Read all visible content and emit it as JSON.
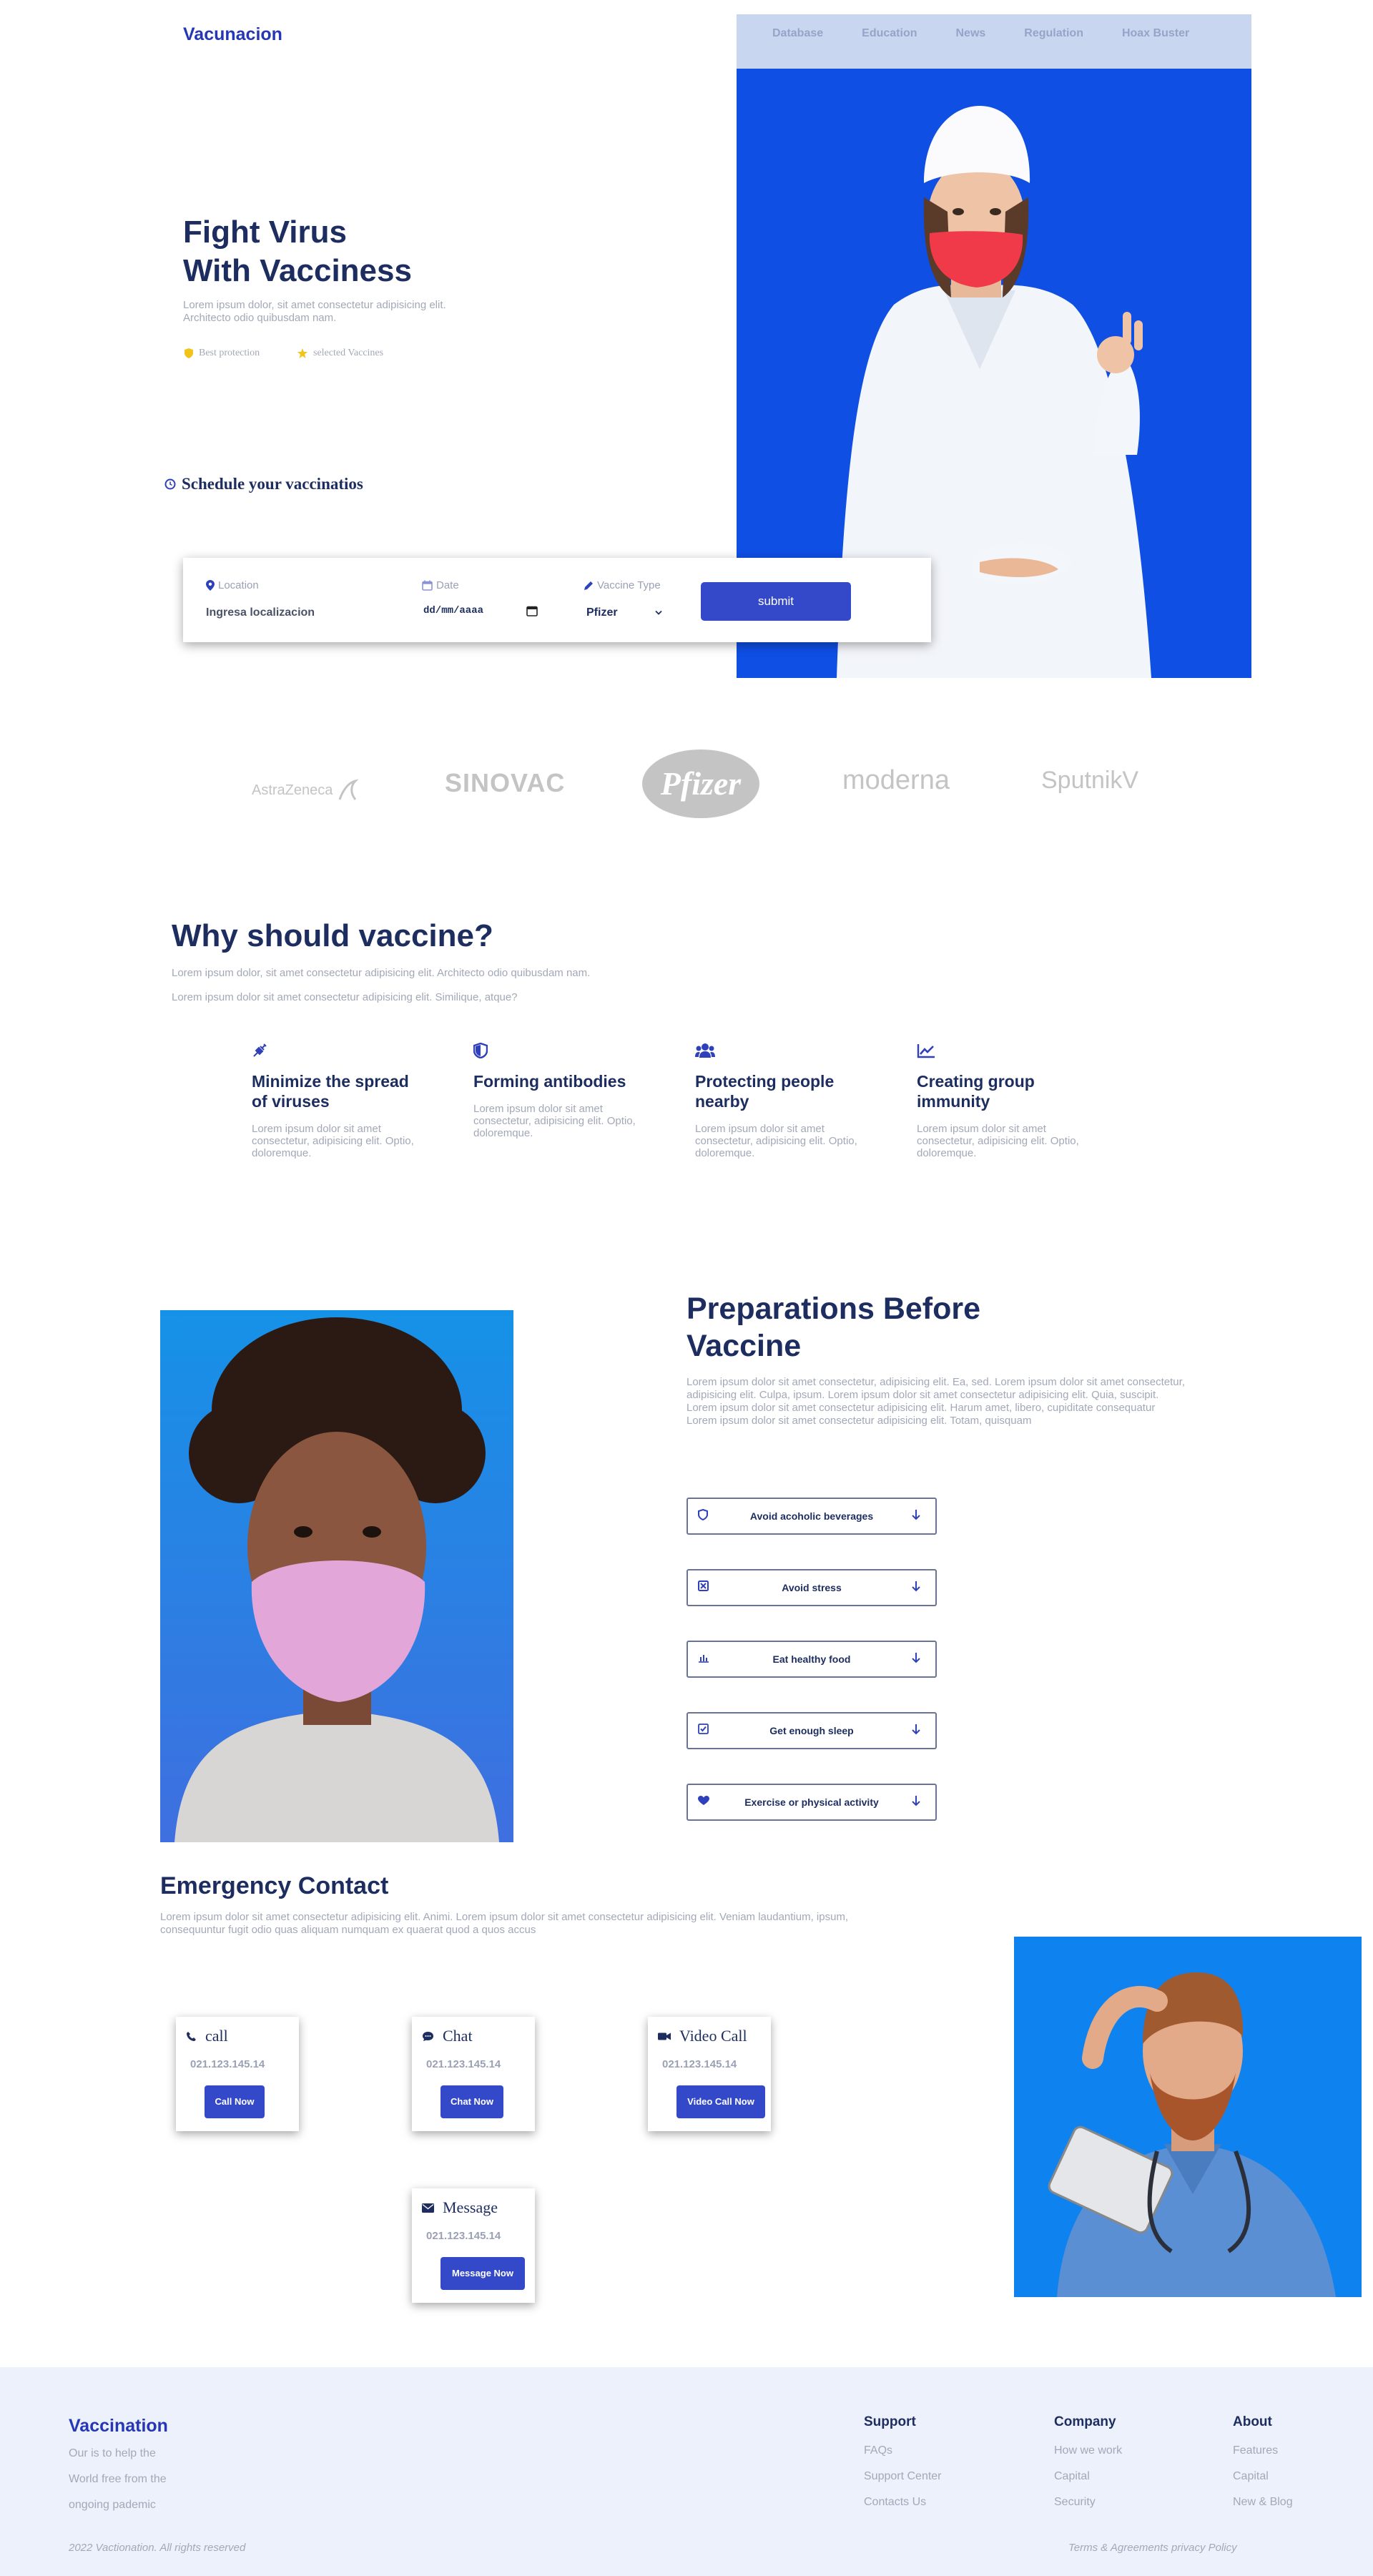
{
  "brand": "Vacunacion",
  "nav": [
    "Database",
    "Education",
    "News",
    "Regulation",
    "Hoax Buster"
  ],
  "hero": {
    "title_line1": "Fight Virus",
    "title_line2": "With Vacciness",
    "subtitle": "Lorem ipsum dolor, sit amet consectetur adipisicing elit. Architecto odio quibusdam nam.",
    "features": [
      "Best protection",
      "selected Vaccines"
    ]
  },
  "schedule": {
    "title": "Schedule your vaccinatios",
    "location_label": "Location",
    "location_value": "Ingresa localizacion",
    "date_label": "Date",
    "date_value": "dd/mm/aaaa",
    "type_label": "Vaccine Type",
    "type_value": "Pfizer",
    "submit": "submit"
  },
  "logos": [
    "AstraZeneca",
    "SINOVAC",
    "Pfizer",
    "moderna",
    "SputnikV"
  ],
  "why": {
    "title": "Why should vaccine?",
    "p1": "Lorem ipsum dolor, sit amet consectetur adipisicing elit. Architecto odio quibusdam nam.",
    "p2": "Lorem ipsum dolor sit amet consectetur adipisicing elit. Similique, atque?",
    "cards": [
      {
        "title": "Minimize the spread of viruses",
        "text": "Lorem ipsum dolor sit amet consectetur, adipisicing elit. Optio, doloremque."
      },
      {
        "title": "Forming antibodies",
        "text": "Lorem ipsum dolor sit amet consectetur, adipisicing elit. Optio, doloremque."
      },
      {
        "title": "Protecting people nearby",
        "text": "Lorem ipsum dolor sit amet consectetur, adipisicing elit. Optio, doloremque."
      },
      {
        "title": "Creating group immunity",
        "text": "Lorem ipsum dolor sit amet consectetur, adipisicing elit. Optio, doloremque."
      }
    ]
  },
  "prep": {
    "title_line1": "Preparations Before",
    "title_line2": "Vaccine",
    "text": "Lorem ipsum dolor sit amet consectetur, adipisicing elit. Ea, sed. Lorem ipsum dolor sit amet consectetur, adipisicing elit. Culpa, ipsum. Lorem ipsum dolor sit amet consectetur adipisicing elit. Quia, suscipit. Lorem ipsum dolor sit amet consectetur adipisicing elit. Harum amet, libero, cupiditate consequatur Lorem ipsum dolor sit amet consectetur adipisicing elit. Totam, quisquam",
    "items": [
      "Avoid acoholic beverages",
      "Avoid stress",
      "Eat healthy food",
      "Get enough sleep",
      "Exercise or physical activity"
    ]
  },
  "emergency": {
    "title": "Emergency Contact",
    "text": "Lorem ipsum dolor sit amet consectetur adipisicing elit. Animi. Lorem ipsum dolor sit amet consectetur adipisicing elit. Veniam laudantium, ipsum, consequuntur fugit odio quas aliquam numquam ex quaerat quod a quos accus",
    "contacts": [
      {
        "title": "call",
        "number": "021.123.145.14",
        "button": "Call Now"
      },
      {
        "title": "Chat",
        "number": "021.123.145.14",
        "button": "Chat Now"
      },
      {
        "title": "Video Call",
        "number": "021.123.145.14",
        "button": "Video Call Now"
      },
      {
        "title": "Message",
        "number": "021.123.145.14",
        "button": "Message Now"
      }
    ]
  },
  "footer": {
    "brand": "Vaccination",
    "tagline": [
      "Our is to help the",
      "World free from the",
      "ongoing pademic"
    ],
    "columns": [
      {
        "title": "Support",
        "links": [
          "FAQs",
          "Support Center",
          "Contacts Us"
        ]
      },
      {
        "title": "Company",
        "links": [
          "How we work",
          "Capital",
          "Security"
        ]
      },
      {
        "title": "About",
        "links": [
          "Features",
          "Capital",
          "New & Blog"
        ]
      }
    ],
    "copyright": "2022 Vactionation. All rights reserved",
    "legal": "Terms & Agreements privacy Policy"
  },
  "colors": {
    "accent": "#3349c9",
    "heading": "#1d2d5f",
    "muted": "#a3a8b8",
    "nav_bg": "#c8d6f0",
    "footer_bg": "#edf1fc"
  }
}
